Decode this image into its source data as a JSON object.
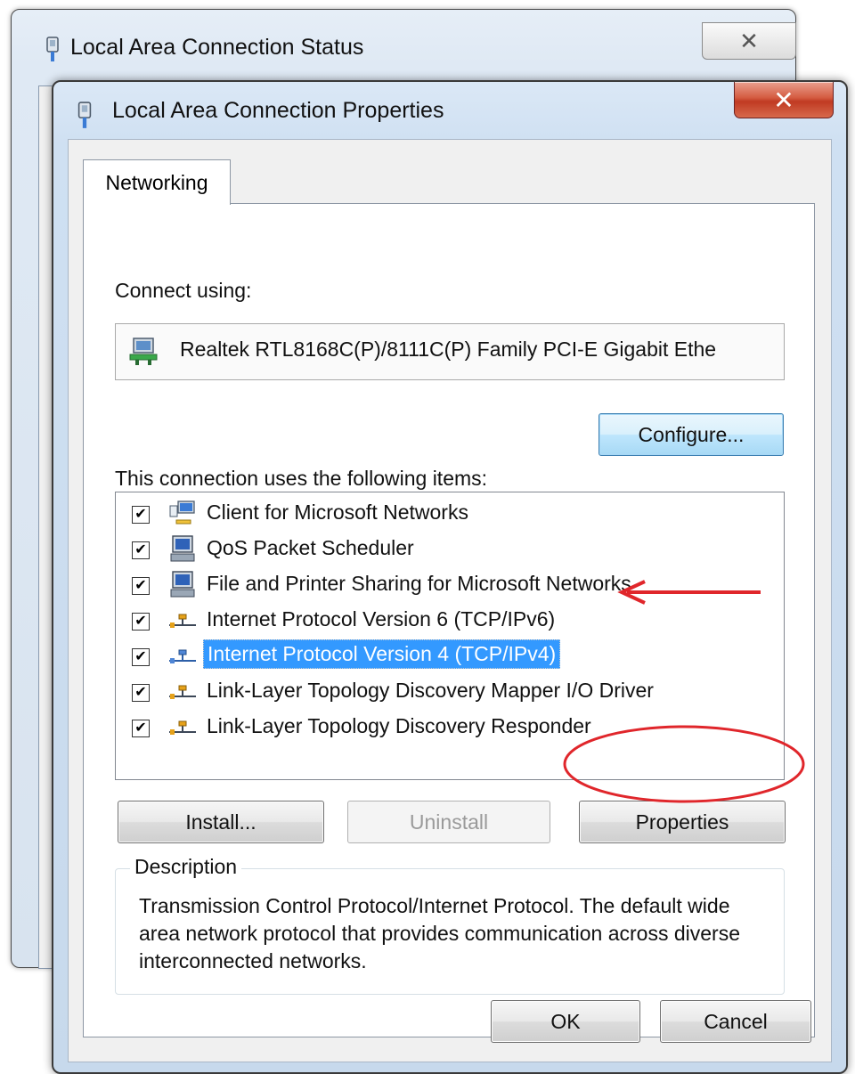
{
  "background_window": {
    "title": "Local Area Connection Status",
    "close_glyph": "✕"
  },
  "window": {
    "title": "Local Area Connection Properties",
    "close_glyph": "✕",
    "icon": "network-plug-icon"
  },
  "tabs": [
    {
      "label": "Networking",
      "active": true
    }
  ],
  "connect_using": {
    "label": "Connect using:",
    "adapter_name": "Realtek RTL8168C(P)/8111C(P) Family PCI-E Gigabit Ethe",
    "adapter_icon": "network-adapter-icon"
  },
  "configure_button": "Configure...",
  "items_label": "This connection uses the following items:",
  "items": [
    {
      "label": "Client for Microsoft Networks",
      "checked": true,
      "icon": "network-client-icon",
      "selected": false
    },
    {
      "label": "QoS Packet Scheduler",
      "checked": true,
      "icon": "computer-service-icon",
      "selected": false
    },
    {
      "label": "File and Printer Sharing for Microsoft Networks",
      "checked": true,
      "icon": "computer-service-icon",
      "selected": false
    },
    {
      "label": "Internet Protocol Version 6 (TCP/IPv6)",
      "checked": true,
      "icon": "protocol-icon",
      "selected": false
    },
    {
      "label": "Internet Protocol Version 4 (TCP/IPv4)",
      "checked": true,
      "icon": "protocol-icon",
      "selected": true
    },
    {
      "label": "Link-Layer Topology Discovery Mapper I/O Driver",
      "checked": true,
      "icon": "protocol-icon",
      "selected": false
    },
    {
      "label": "Link-Layer Topology Discovery Responder",
      "checked": true,
      "icon": "protocol-icon",
      "selected": false
    }
  ],
  "buttons": {
    "install": "Install...",
    "uninstall": "Uninstall",
    "properties": "Properties",
    "ok": "OK",
    "cancel": "Cancel"
  },
  "description": {
    "legend": "Description",
    "text": "Transmission Control Protocol/Internet Protocol. The default wide area network protocol that provides communication across diverse interconnected networks."
  },
  "check_glyph": "✔",
  "colors": {
    "selection": "#3399ff",
    "annotation": "#e0262b",
    "close_button": "#c9452c"
  }
}
